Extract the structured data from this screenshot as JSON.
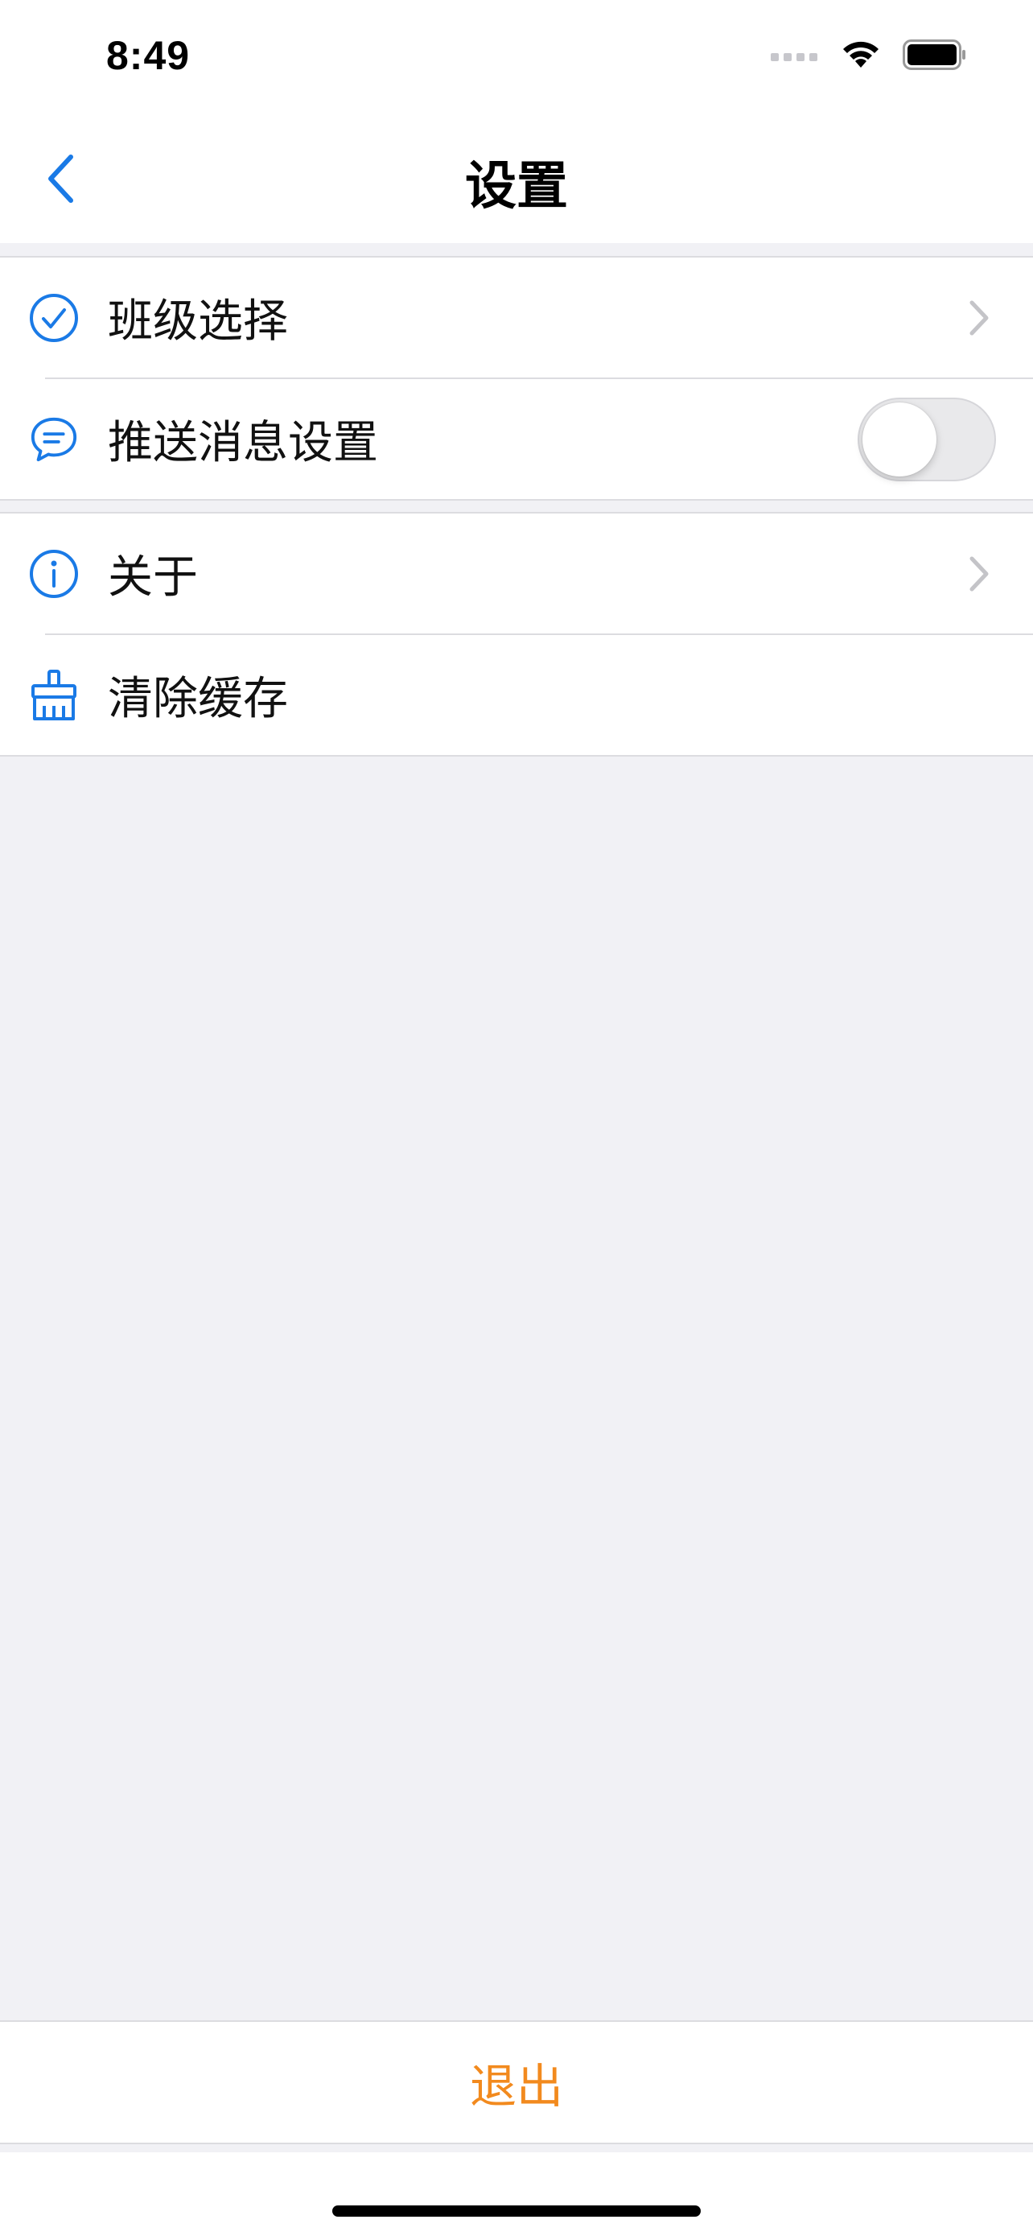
{
  "status_bar": {
    "time": "8:49"
  },
  "nav": {
    "title": "设置"
  },
  "groups": [
    {
      "items": [
        {
          "label": "班级选择",
          "icon": "check-circle-icon",
          "accessory": "chevron"
        },
        {
          "label": "推送消息设置",
          "icon": "message-bubble-icon",
          "accessory": "toggle",
          "toggle_on": false
        }
      ]
    },
    {
      "items": [
        {
          "label": "关于",
          "icon": "info-circle-icon",
          "accessory": "chevron"
        },
        {
          "label": "清除缓存",
          "icon": "broom-icon",
          "accessory": "none"
        }
      ]
    }
  ],
  "logout": {
    "label": "退出"
  },
  "colors": {
    "accent": "#1a7ae6",
    "logout": "#f28a1e",
    "background": "#f1f1f5",
    "separator": "#dcdce0"
  }
}
